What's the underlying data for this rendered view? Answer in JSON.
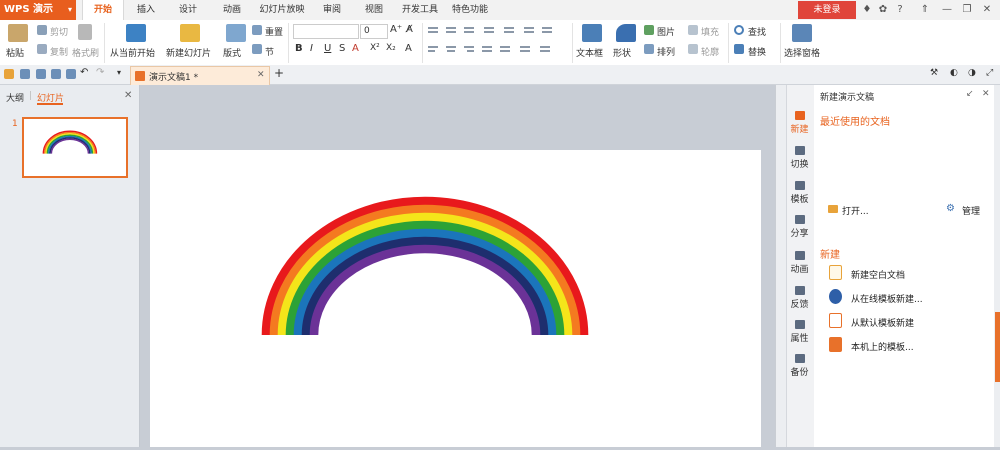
{
  "app": {
    "name": "WPS 演示"
  },
  "menu": {
    "tabs": [
      "开始",
      "插入",
      "设计",
      "动画",
      "幻灯片放映",
      "审阅",
      "视图",
      "开发工具",
      "特色功能"
    ],
    "active_index": 0
  },
  "account": {
    "login_label": "未登录"
  },
  "ribbon": {
    "paste": "粘贴",
    "cut": "剪切",
    "copy": "复制",
    "format_painter": "格式刷",
    "from_current": "从当前开始",
    "new_slide": "新建幻灯片",
    "layout": "版式",
    "reset": "重置",
    "section": "节",
    "font_size": "0",
    "text_box": "文本框",
    "shape": "形状",
    "picture": "图片",
    "arrange": "排列",
    "fill": "填充",
    "outline": "轮廓",
    "find": "查找",
    "replace": "替换",
    "selection_pane": "选择窗格"
  },
  "doc_tab": {
    "title": "演示文稿1 *"
  },
  "left_panel": {
    "tab_outline": "大纲",
    "tab_slides": "幻灯片",
    "slide_number": "1"
  },
  "right_nav": [
    "新建",
    "切换",
    "模板",
    "分享",
    "动画",
    "反馈",
    "属性",
    "备份"
  ],
  "task_pane": {
    "title": "新建演示文稿",
    "recent_heading": "最近使用的文档",
    "open_label": "打开...",
    "manage_label": "管理",
    "new_heading": "新建",
    "new_items": [
      "新建空白文档",
      "从在线模板新建...",
      "从默认模板新建",
      "本机上的模板..."
    ]
  },
  "colors": {
    "accent": "#e8631f",
    "rainbow": [
      "#e8191c",
      "#f47a20",
      "#f4e51a",
      "#2ca236",
      "#1b75bb",
      "#1e2e6e",
      "#6b3297"
    ]
  }
}
